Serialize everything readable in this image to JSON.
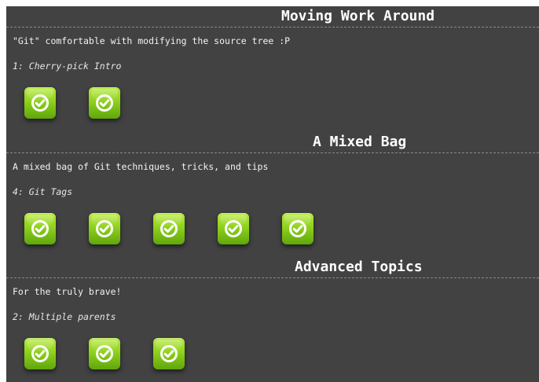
{
  "sections": [
    {
      "title": "Moving Work Around",
      "description": "\"Git\" comfortable with modifying the source tree :P",
      "current_level": "1: Cherry-pick Intro",
      "completed_levels": 2
    },
    {
      "title": "A Mixed Bag",
      "description": "A mixed bag of Git techniques, tricks, and tips",
      "current_level": "4: Git Tags",
      "completed_levels": 5
    },
    {
      "title": "Advanced Topics",
      "description": "For the truly brave!",
      "current_level": "2: Multiple parents",
      "completed_levels": 3
    }
  ],
  "icon": "check-circle-icon",
  "colors": {
    "background": "#424242",
    "icon_green": "#8fd11d",
    "text": "#f0f0f0"
  }
}
